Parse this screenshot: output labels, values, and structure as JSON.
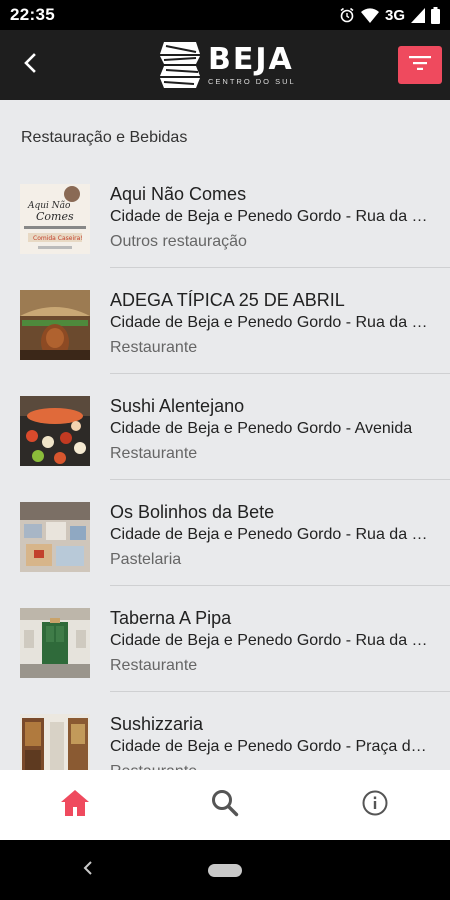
{
  "status_bar": {
    "time": "22:35",
    "network": "3G"
  },
  "header": {
    "logo_title": "BEJA",
    "logo_subtitle": "CENTRO DO SUL",
    "accent_color": "#ef4a5e"
  },
  "section": {
    "title": "Restauração e Bebidas"
  },
  "items": [
    {
      "name": "Aqui Não Comes",
      "address": "Cidade de Beja e Penedo Gordo - Rua da Moeda",
      "category": "Outros restauração"
    },
    {
      "name": "ADEGA TÍPICA 25 DE ABRIL",
      "address": "Cidade de Beja e Penedo Gordo - Rua da Moeda",
      "category": "Restaurante"
    },
    {
      "name": "Sushi Alentejano",
      "address": "Cidade de Beja e Penedo Gordo - Avenida",
      "category": "Restaurante"
    },
    {
      "name": "Os Bolinhos da Bete",
      "address": "Cidade de Beja e Penedo Gordo - Rua da Moeda",
      "category": "Pastelaria"
    },
    {
      "name": "Taberna A Pipa",
      "address": "Cidade de Beja e Penedo Gordo - Rua da Moeda",
      "category": "Restaurante"
    },
    {
      "name": "Sushizzaria",
      "address": "Cidade de Beja e Penedo Gordo - Praça da República",
      "category": "Restaurante"
    }
  ],
  "bottom_nav": {
    "items": [
      {
        "icon": "home-icon",
        "active": true
      },
      {
        "icon": "search-icon",
        "active": false
      },
      {
        "icon": "info-icon",
        "active": false
      }
    ]
  }
}
